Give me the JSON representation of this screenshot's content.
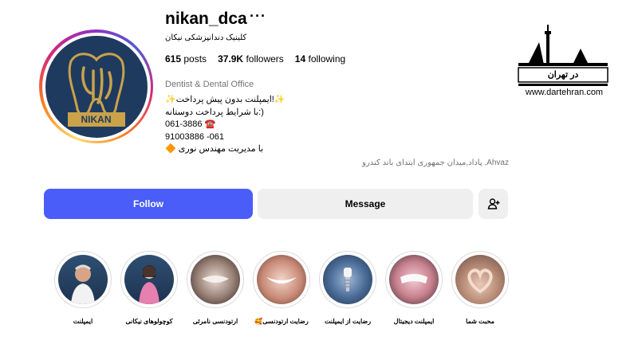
{
  "profile": {
    "username": "nikan_dca",
    "more_label": "···",
    "full_name": "کلینیک دندانپزشکی نیکان",
    "avatar_text": "NIKAN",
    "stats": {
      "posts_num": "615",
      "posts_label": "posts",
      "followers_num": "37.9K",
      "followers_label": "followers",
      "following_num": "14",
      "following_label": "following"
    },
    "category": "Dentist & Dental Office",
    "bio": [
      "✨ایمپلنت بدون پیش پرداخت!✨",
      "با شرایط پرداخت دوستانه:)",
      "061-3886 ☎️",
      "91003886 -061",
      "🔶 با مدیریت مهندس نوری"
    ],
    "address": "پاداد,میدان جمهوری ابتدای باند کندرو ,Ahvaz"
  },
  "actions": {
    "follow": "Follow",
    "message": "Message"
  },
  "brand": {
    "title": "در تهران",
    "url": "www.dartehran.com"
  },
  "highlights": [
    {
      "label": "محبت شما"
    },
    {
      "label": "ایمپلنت دیجیتال"
    },
    {
      "label": "رضایت از ایمپلنت"
    },
    {
      "label": "رضایت ارتودنسی🥰"
    },
    {
      "label": "ارتودنسی نامرئی"
    },
    {
      "label": "کوچولوهای نیکانی"
    },
    {
      "label": "ایمپلنت"
    }
  ],
  "colors": {
    "follow_button": "#4a5df9",
    "secondary_button": "#efefef",
    "avatar_bg": "#1f3a5f",
    "avatar_gold": "#c9a24a"
  }
}
